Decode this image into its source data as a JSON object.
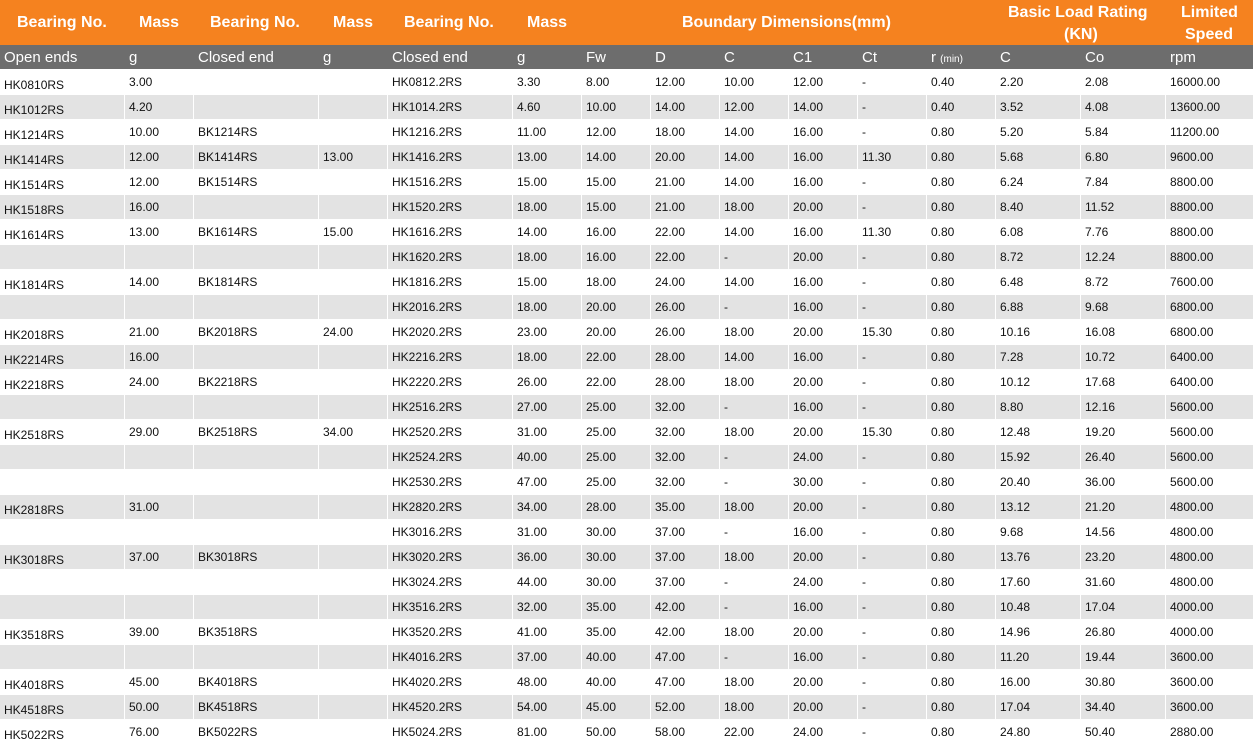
{
  "header": {
    "bearing_no_1": "Bearing No.",
    "mass_1": "Mass",
    "bearing_no_2": "Bearing No.",
    "mass_2": "Mass",
    "bearing_no_3": "Bearing No.",
    "mass_3": "Mass",
    "boundary": "Boundary Dimensions(mm)",
    "load_rating_line1": "Basic Load Rating",
    "load_rating_line2": "(KN)",
    "speed_line1": "Limited",
    "speed_line2": "Speed"
  },
  "subheader": {
    "open_ends": "Open ends",
    "g1": "g",
    "closed_end_1": "Closed end",
    "g2": "g",
    "closed_end_2": "Closed end",
    "g3": "g",
    "fw": "Fw",
    "d": "D",
    "c": "C",
    "c1": "C1",
    "ct": "Ct",
    "r": "r",
    "r_min": "(min)",
    "c_load": "C",
    "co": "Co",
    "rpm": "rpm"
  },
  "rows": [
    [
      "HK0810RS",
      "3.00",
      "",
      "",
      "HK0812.2RS",
      "3.30",
      "8.00",
      "12.00",
      "10.00",
      "12.00",
      "-",
      "0.40",
      "2.20",
      "2.08",
      "16000.00"
    ],
    [
      "HK1012RS",
      "4.20",
      "",
      "",
      "HK1014.2RS",
      "4.60",
      "10.00",
      "14.00",
      "12.00",
      "14.00",
      "-",
      "0.40",
      "3.52",
      "4.08",
      "13600.00"
    ],
    [
      "HK1214RS",
      "10.00",
      "BK1214RS",
      "",
      "HK1216.2RS",
      "11.00",
      "12.00",
      "18.00",
      "14.00",
      "16.00",
      "-",
      "0.80",
      "5.20",
      "5.84",
      "11200.00"
    ],
    [
      "HK1414RS",
      "12.00",
      "BK1414RS",
      "13.00",
      "HK1416.2RS",
      "13.00",
      "14.00",
      "20.00",
      "14.00",
      "16.00",
      "11.30",
      "0.80",
      "5.68",
      "6.80",
      "9600.00"
    ],
    [
      "HK1514RS",
      "12.00",
      "BK1514RS",
      "",
      "HK1516.2RS",
      "15.00",
      "15.00",
      "21.00",
      "14.00",
      "16.00",
      "-",
      "0.80",
      "6.24",
      "7.84",
      "8800.00"
    ],
    [
      "HK1518RS",
      "16.00",
      "",
      "",
      "HK1520.2RS",
      "18.00",
      "15.00",
      "21.00",
      "18.00",
      "20.00",
      "-",
      "0.80",
      "8.40",
      "11.52",
      "8800.00"
    ],
    [
      "HK1614RS",
      "13.00",
      "BK1614RS",
      "15.00",
      "HK1616.2RS",
      "14.00",
      "16.00",
      "22.00",
      "14.00",
      "16.00",
      "11.30",
      "0.80",
      "6.08",
      "7.76",
      "8800.00"
    ],
    [
      "",
      "",
      "",
      "",
      "HK1620.2RS",
      "18.00",
      "16.00",
      "22.00",
      "-",
      "20.00",
      "-",
      "0.80",
      "8.72",
      "12.24",
      "8800.00"
    ],
    [
      "HK1814RS",
      "14.00",
      "BK1814RS",
      "",
      "HK1816.2RS",
      "15.00",
      "18.00",
      "24.00",
      "14.00",
      "16.00",
      "-",
      "0.80",
      "6.48",
      "8.72",
      "7600.00"
    ],
    [
      "",
      "",
      "",
      "",
      "HK2016.2RS",
      "18.00",
      "20.00",
      "26.00",
      "-",
      "16.00",
      "-",
      "0.80",
      "6.88",
      "9.68",
      "6800.00"
    ],
    [
      "HK2018RS",
      "21.00",
      "BK2018RS",
      "24.00",
      "HK2020.2RS",
      "23.00",
      "20.00",
      "26.00",
      "18.00",
      "20.00",
      "15.30",
      "0.80",
      "10.16",
      "16.08",
      "6800.00"
    ],
    [
      "HK2214RS",
      "16.00",
      "",
      "",
      "HK2216.2RS",
      "18.00",
      "22.00",
      "28.00",
      "14.00",
      "16.00",
      "-",
      "0.80",
      "7.28",
      "10.72",
      "6400.00"
    ],
    [
      "HK2218RS",
      "24.00",
      "BK2218RS",
      "",
      "HK2220.2RS",
      "26.00",
      "22.00",
      "28.00",
      "18.00",
      "20.00",
      "-",
      "0.80",
      "10.12",
      "17.68",
      "6400.00"
    ],
    [
      "",
      "",
      "",
      "",
      "HK2516.2RS",
      "27.00",
      "25.00",
      "32.00",
      "-",
      "16.00",
      "-",
      "0.80",
      "8.80",
      "12.16",
      "5600.00"
    ],
    [
      "HK2518RS",
      "29.00",
      "BK2518RS",
      "34.00",
      "HK2520.2RS",
      "31.00",
      "25.00",
      "32.00",
      "18.00",
      "20.00",
      "15.30",
      "0.80",
      "12.48",
      "19.20",
      "5600.00"
    ],
    [
      "",
      "",
      "",
      "",
      "HK2524.2RS",
      "40.00",
      "25.00",
      "32.00",
      "-",
      "24.00",
      "-",
      "0.80",
      "15.92",
      "26.40",
      "5600.00"
    ],
    [
      "",
      "",
      "",
      "",
      "HK2530.2RS",
      "47.00",
      "25.00",
      "32.00",
      "-",
      "30.00",
      "-",
      "0.80",
      "20.40",
      "36.00",
      "5600.00"
    ],
    [
      "HK2818RS",
      "31.00",
      "",
      "",
      "HK2820.2RS",
      "34.00",
      "28.00",
      "35.00",
      "18.00",
      "20.00",
      "-",
      "0.80",
      "13.12",
      "21.20",
      "4800.00"
    ],
    [
      "",
      "",
      "",
      "",
      "HK3016.2RS",
      "31.00",
      "30.00",
      "37.00",
      "-",
      "16.00",
      "-",
      "0.80",
      "9.68",
      "14.56",
      "4800.00"
    ],
    [
      "HK3018RS",
      "37.00",
      "BK3018RS",
      "",
      "HK3020.2RS",
      "36.00",
      "30.00",
      "37.00",
      "18.00",
      "20.00",
      "-",
      "0.80",
      "13.76",
      "23.20",
      "4800.00"
    ],
    [
      "",
      "",
      "",
      "",
      "HK3024.2RS",
      "44.00",
      "30.00",
      "37.00",
      "-",
      "24.00",
      "-",
      "0.80",
      "17.60",
      "31.60",
      "4800.00"
    ],
    [
      "",
      "",
      "",
      "",
      "HK3516.2RS",
      "32.00",
      "35.00",
      "42.00",
      "-",
      "16.00",
      "-",
      "0.80",
      "10.48",
      "17.04",
      "4000.00"
    ],
    [
      "HK3518RS",
      "39.00",
      "BK3518RS",
      "",
      "HK3520.2RS",
      "41.00",
      "35.00",
      "42.00",
      "18.00",
      "20.00",
      "-",
      "0.80",
      "14.96",
      "26.80",
      "4000.00"
    ],
    [
      "",
      "",
      "",
      "",
      "HK4016.2RS",
      "37.00",
      "40.00",
      "47.00",
      "-",
      "16.00",
      "-",
      "0.80",
      "11.20",
      "19.44",
      "3600.00"
    ],
    [
      "HK4018RS",
      "45.00",
      "BK4018RS",
      "",
      "HK4020.2RS",
      "48.00",
      "40.00",
      "47.00",
      "18.00",
      "20.00",
      "-",
      "0.80",
      "16.00",
      "30.80",
      "3600.00"
    ],
    [
      "HK4518RS",
      "50.00",
      "BK4518RS",
      "",
      "HK4520.2RS",
      "54.00",
      "45.00",
      "52.00",
      "18.00",
      "20.00",
      "-",
      "0.80",
      "17.04",
      "34.40",
      "3600.00"
    ],
    [
      "HK5022RS",
      "76.00",
      "BK5022RS",
      "",
      "HK5024.2RS",
      "81.00",
      "50.00",
      "58.00",
      "22.00",
      "24.00",
      "-",
      "0.80",
      "24.80",
      "50.40",
      "2880.00"
    ]
  ],
  "colors": {
    "header_orange": "#f5821f",
    "subheader_gray": "#6d6d6d",
    "row_shade": "#e3e3e3"
  }
}
